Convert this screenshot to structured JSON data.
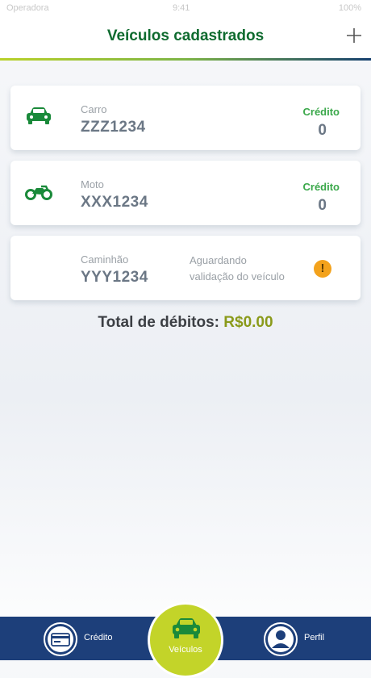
{
  "status_bar": {
    "carrier": "Operadora",
    "time": "9:41",
    "battery": "100%"
  },
  "header": {
    "title": "Veículos cadastrados",
    "add_icon": "plus-icon"
  },
  "vehicles": [
    {
      "icon": "car-icon",
      "type": "Carro",
      "plate": "ZZZ1234",
      "credit_label": "Crédito",
      "credit_value": "0"
    },
    {
      "icon": "motorcycle-icon",
      "type": "Moto",
      "plate": "XXX1234",
      "credit_label": "Crédito",
      "credit_value": "0"
    },
    {
      "icon": "",
      "type": "Caminhão",
      "plate": "YYY1234",
      "status_line1": "Aguardando",
      "status_line2": "validação do veículo",
      "status_icon": "warning-icon"
    }
  ],
  "total": {
    "label": "Total de débitos:",
    "amount": "R$0.00"
  },
  "tabs": [
    {
      "label": "Crédito",
      "icon": "credit-card-icon"
    },
    {
      "label": "Veículos",
      "icon": "car-icon",
      "active": true
    },
    {
      "label": "Perfil",
      "icon": "user-icon"
    }
  ],
  "colors": {
    "title_green": "#0f6b2f",
    "credit_green": "#3aa84a",
    "icon_green": "#1a8a3a",
    "amount_olive": "#8a9a1a",
    "tabbar_blue": "#1d3f7a",
    "active_tab_lime": "#c3d429",
    "warning_orange": "#f3a21c"
  }
}
